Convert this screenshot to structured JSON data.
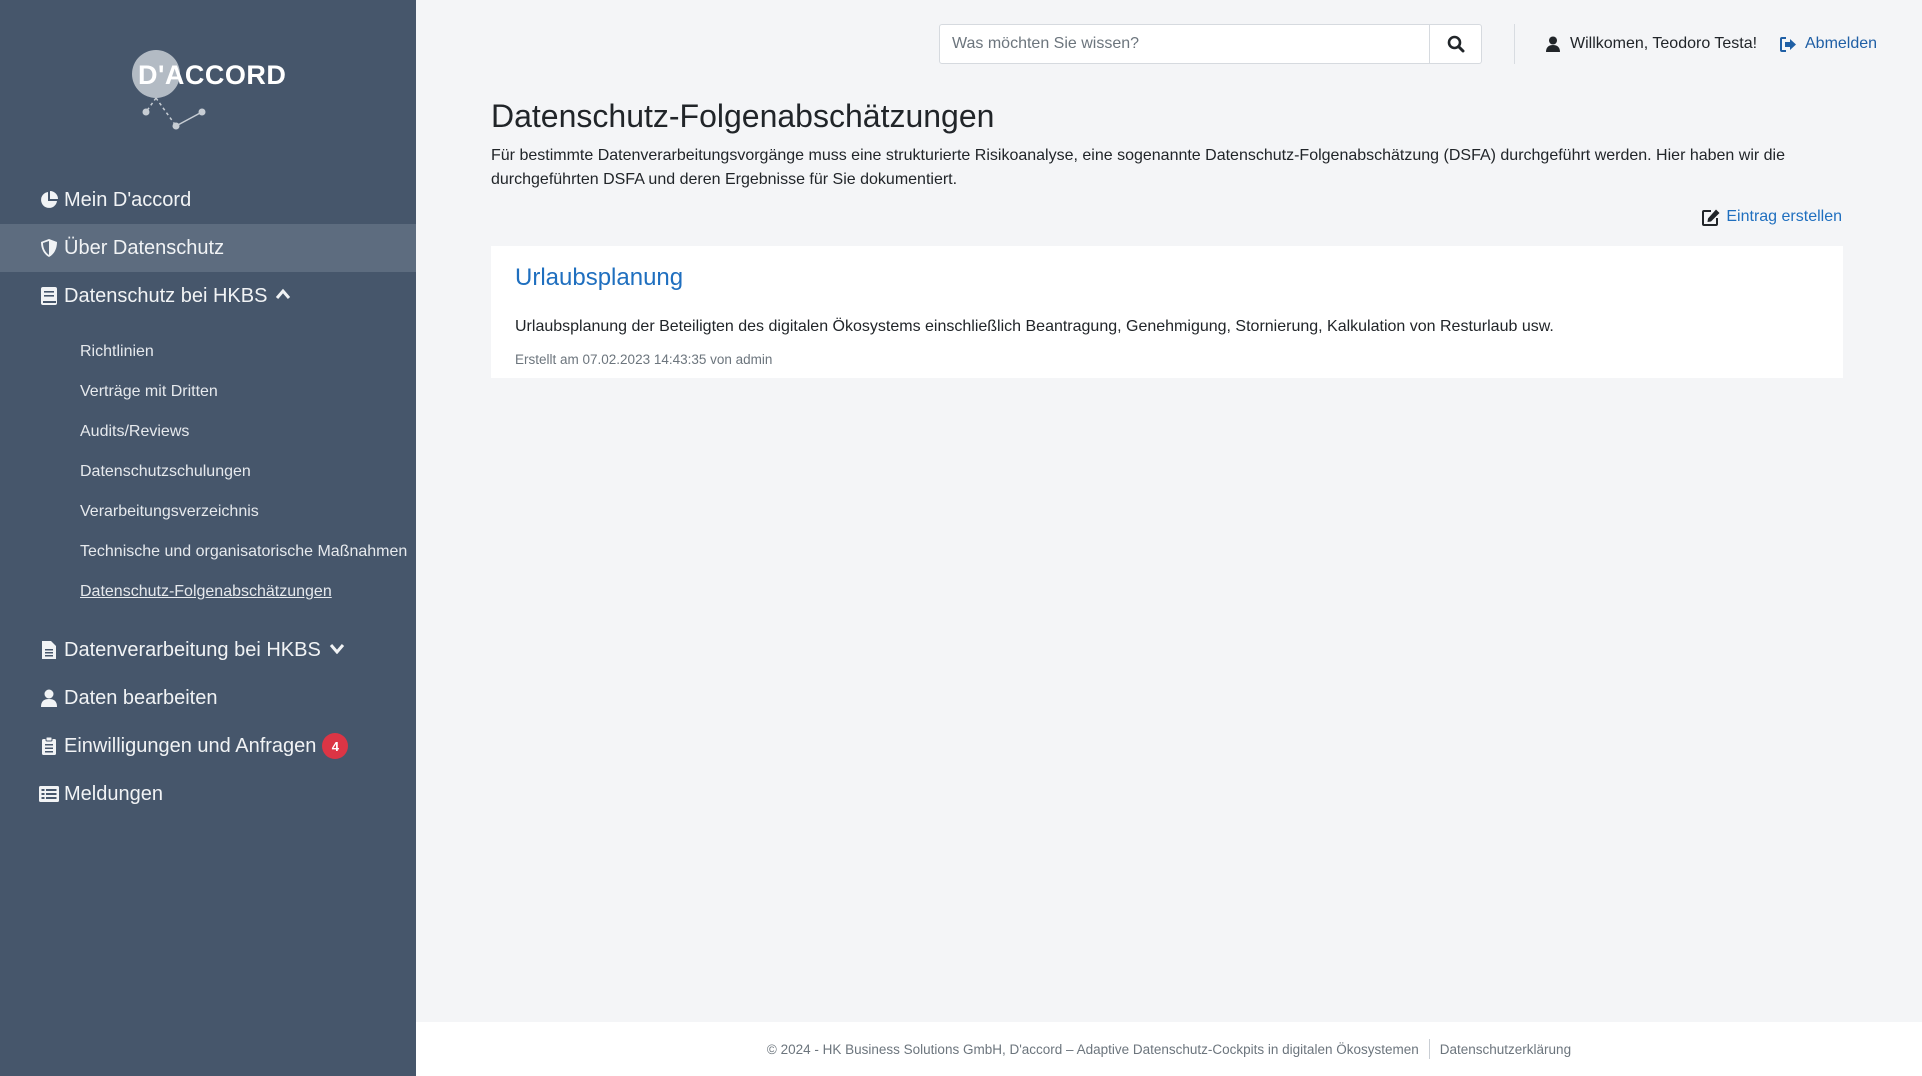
{
  "brand": {
    "logo_text": "D'ACCORD"
  },
  "sidebar": {
    "items": [
      {
        "label": "Mein D'accord",
        "icon": "pie-chart-icon"
      },
      {
        "label": "Über Datenschutz",
        "icon": "shield-icon"
      },
      {
        "label": "Datenschutz bei HKBS",
        "icon": "book-icon"
      },
      {
        "label": "Datenverarbeitung bei HKBS",
        "icon": "file-icon"
      },
      {
        "label": "Daten bearbeiten",
        "icon": "user-icon"
      },
      {
        "label": "Einwilligungen und Anfragen",
        "icon": "clipboard-icon",
        "badge": "4"
      },
      {
        "label": "Meldungen",
        "icon": "list-icon"
      }
    ],
    "subitems": [
      "Richtlinien",
      "Verträge mit Dritten",
      "Audits/Reviews",
      "Datenschutzschulungen",
      "Verarbeitungsverzeichnis",
      "Technische und organisatorische Maßnahmen",
      "Datenschutz-Folgenabschätzungen"
    ]
  },
  "header": {
    "search_placeholder": "Was möchten Sie wissen?",
    "welcome": "Willkomen, Teodoro Testa!",
    "logout": "Abmelden"
  },
  "main": {
    "title": "Datenschutz-Folgenabschätzungen",
    "description": "Für bestimmte Datenverarbeitungsvorgänge muss eine strukturierte Risikoanalyse, eine sogenannte Datenschutz-Folgenabschätzung (DSFA) durchgeführt werden. Hier haben wir die durchgeführten DSFA und deren Ergebnisse für Sie dokumentiert.",
    "create_label": "Eintrag erstellen",
    "entries": [
      {
        "title": "Urlaubsplanung",
        "text": "Urlaubsplanung der Beteiligten des digitalen Ökosystems einschließlich Beantragung, Genehmigung, Stornierung, Kalkulation von Resturlaub usw.",
        "meta": "Erstellt am 07.02.2023 14:43:35 von admin"
      }
    ]
  },
  "footer": {
    "copyright": "© 2024 - HK Business Solutions GmbH, D'accord – Adaptive Datenschutz-Cockpits in digitalen Ökosystemen",
    "privacy": "Datenschutzerklärung"
  },
  "colors": {
    "sidebar_bg": "#46566b",
    "sidebar_active": "#5d6c7f",
    "link": "#1f6fbf",
    "badge": "#dc3545"
  }
}
